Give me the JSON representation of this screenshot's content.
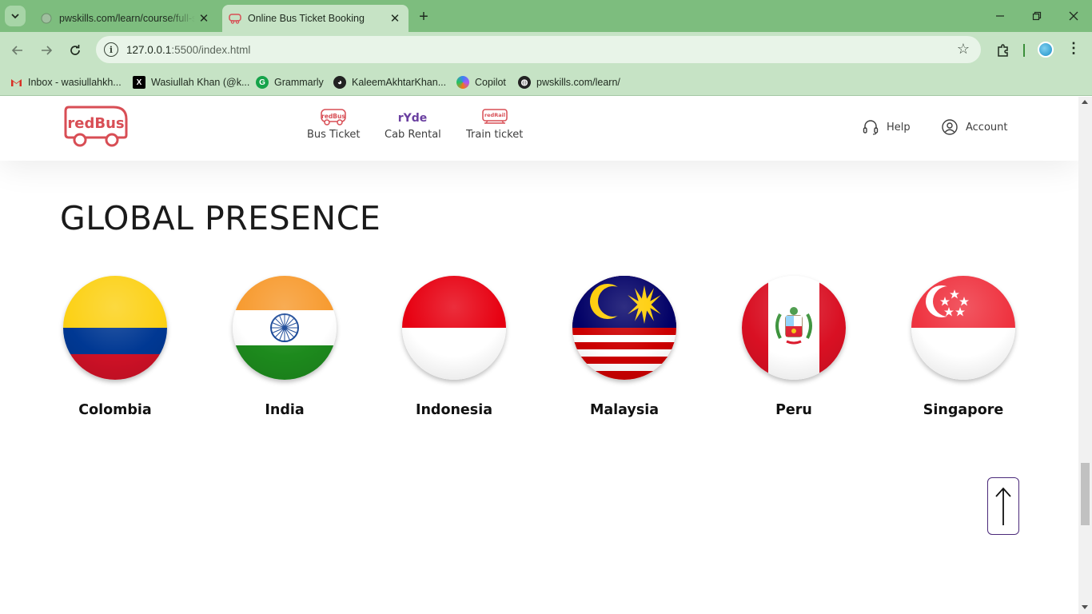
{
  "browser": {
    "tabs": [
      {
        "title": "pwskills.com/learn/course/full-s",
        "active": false
      },
      {
        "title": "Online Bus Ticket Booking",
        "active": true
      }
    ],
    "url": {
      "host": "127.0.0.1",
      "rest": ":5500/index.html"
    },
    "bookmarks": [
      {
        "label": "Inbox - wasiullahkh...",
        "icon": "gmail-icon"
      },
      {
        "label": "Wasiullah Khan (@k...",
        "icon": "x-icon"
      },
      {
        "label": "Grammarly",
        "icon": "grammarly-icon"
      },
      {
        "label": "KaleemAkhtarKhan...",
        "icon": "github-icon"
      },
      {
        "label": "Copilot",
        "icon": "copilot-icon"
      },
      {
        "label": "pwskills.com/learn/",
        "icon": "globe-icon"
      }
    ]
  },
  "header": {
    "logo_text": "redBus",
    "nav": [
      {
        "label": "Bus Ticket",
        "icon": "bus-ticket-icon",
        "icon_text": "redBus"
      },
      {
        "label": "Cab Rental",
        "icon": "ryde-icon",
        "icon_text": "rYde"
      },
      {
        "label": "Train ticket",
        "icon": "train-icon",
        "icon_text": "redRail"
      }
    ],
    "help_label": "Help",
    "account_label": "Account"
  },
  "section": {
    "title": "GLOBAL PRESENCE",
    "countries": [
      {
        "name": "Colombia"
      },
      {
        "name": "India"
      },
      {
        "name": "Indonesia"
      },
      {
        "name": "Malaysia"
      },
      {
        "name": "Peru"
      },
      {
        "name": "Singapore"
      }
    ]
  },
  "colors": {
    "brand_red": "#d84e55",
    "tab_green": "#7dbd7e",
    "toolbar_green": "#c6e3c5",
    "scroll_top_border": "#4b2a7a"
  }
}
